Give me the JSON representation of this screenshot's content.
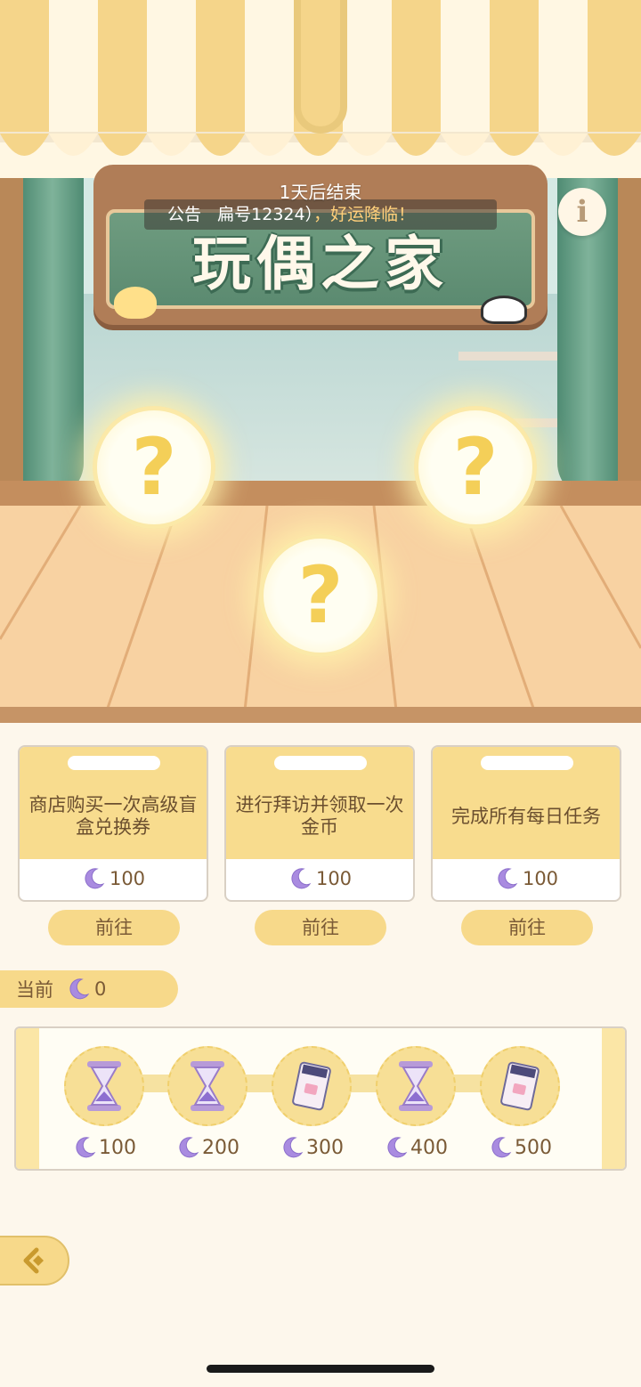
{
  "event": {
    "countdown": "1天后结束",
    "title": "玩偶之家",
    "announcement": {
      "prefix": "公告",
      "body": "扁号12324）",
      "highlight": "，好运降临！"
    },
    "mystery_symbol": "?"
  },
  "tasks": [
    {
      "desc": "商店购买一次高级盲盒兑换券",
      "reward": "100",
      "button": "前往"
    },
    {
      "desc": "进行拜访并领取一次金币",
      "reward": "100",
      "button": "前往"
    },
    {
      "desc": "完成所有每日任务",
      "reward": "100",
      "button": "前往"
    }
  ],
  "current": {
    "label": "当前",
    "value": "0"
  },
  "milestones": [
    {
      "cost": "100",
      "icon": "hourglass-icon"
    },
    {
      "cost": "200",
      "icon": "hourglass-icon"
    },
    {
      "cost": "300",
      "icon": "ticket-icon"
    },
    {
      "cost": "400",
      "icon": "hourglass-icon"
    },
    {
      "cost": "500",
      "icon": "ticket-icon"
    }
  ],
  "colors": {
    "accent": "#f7d98a",
    "moon": "#a98be0",
    "text": "#7a5a36",
    "sign_green": "#6f9c80"
  }
}
